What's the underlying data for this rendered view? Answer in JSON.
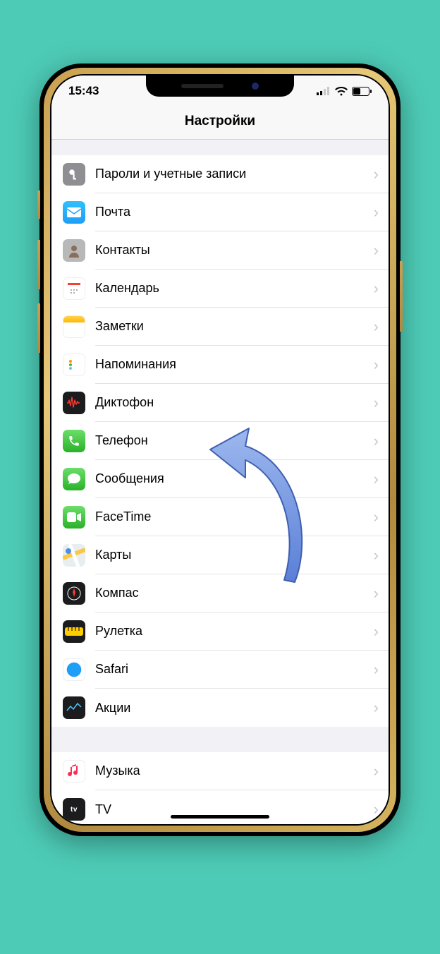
{
  "status": {
    "time": "15:43"
  },
  "header": {
    "title": "Настройки"
  },
  "groups": [
    {
      "items": [
        {
          "key": "passwords",
          "label": "Пароли и учетные записи"
        },
        {
          "key": "mail",
          "label": "Почта"
        },
        {
          "key": "contacts",
          "label": "Контакты"
        },
        {
          "key": "calendar",
          "label": "Календарь"
        },
        {
          "key": "notes",
          "label": "Заметки"
        },
        {
          "key": "reminders",
          "label": "Напоминания"
        },
        {
          "key": "voice",
          "label": "Диктофон"
        },
        {
          "key": "phone",
          "label": "Телефон"
        },
        {
          "key": "messages",
          "label": "Сообщения"
        },
        {
          "key": "facetime",
          "label": "FaceTime"
        },
        {
          "key": "maps",
          "label": "Карты"
        },
        {
          "key": "compass",
          "label": "Компас"
        },
        {
          "key": "measure",
          "label": "Рулетка"
        },
        {
          "key": "safari",
          "label": "Safari"
        },
        {
          "key": "stocks",
          "label": "Акции"
        }
      ]
    },
    {
      "items": [
        {
          "key": "music",
          "label": "Музыка"
        },
        {
          "key": "tv",
          "label": "TV"
        }
      ]
    }
  ],
  "annotation": {
    "target": "phone"
  }
}
